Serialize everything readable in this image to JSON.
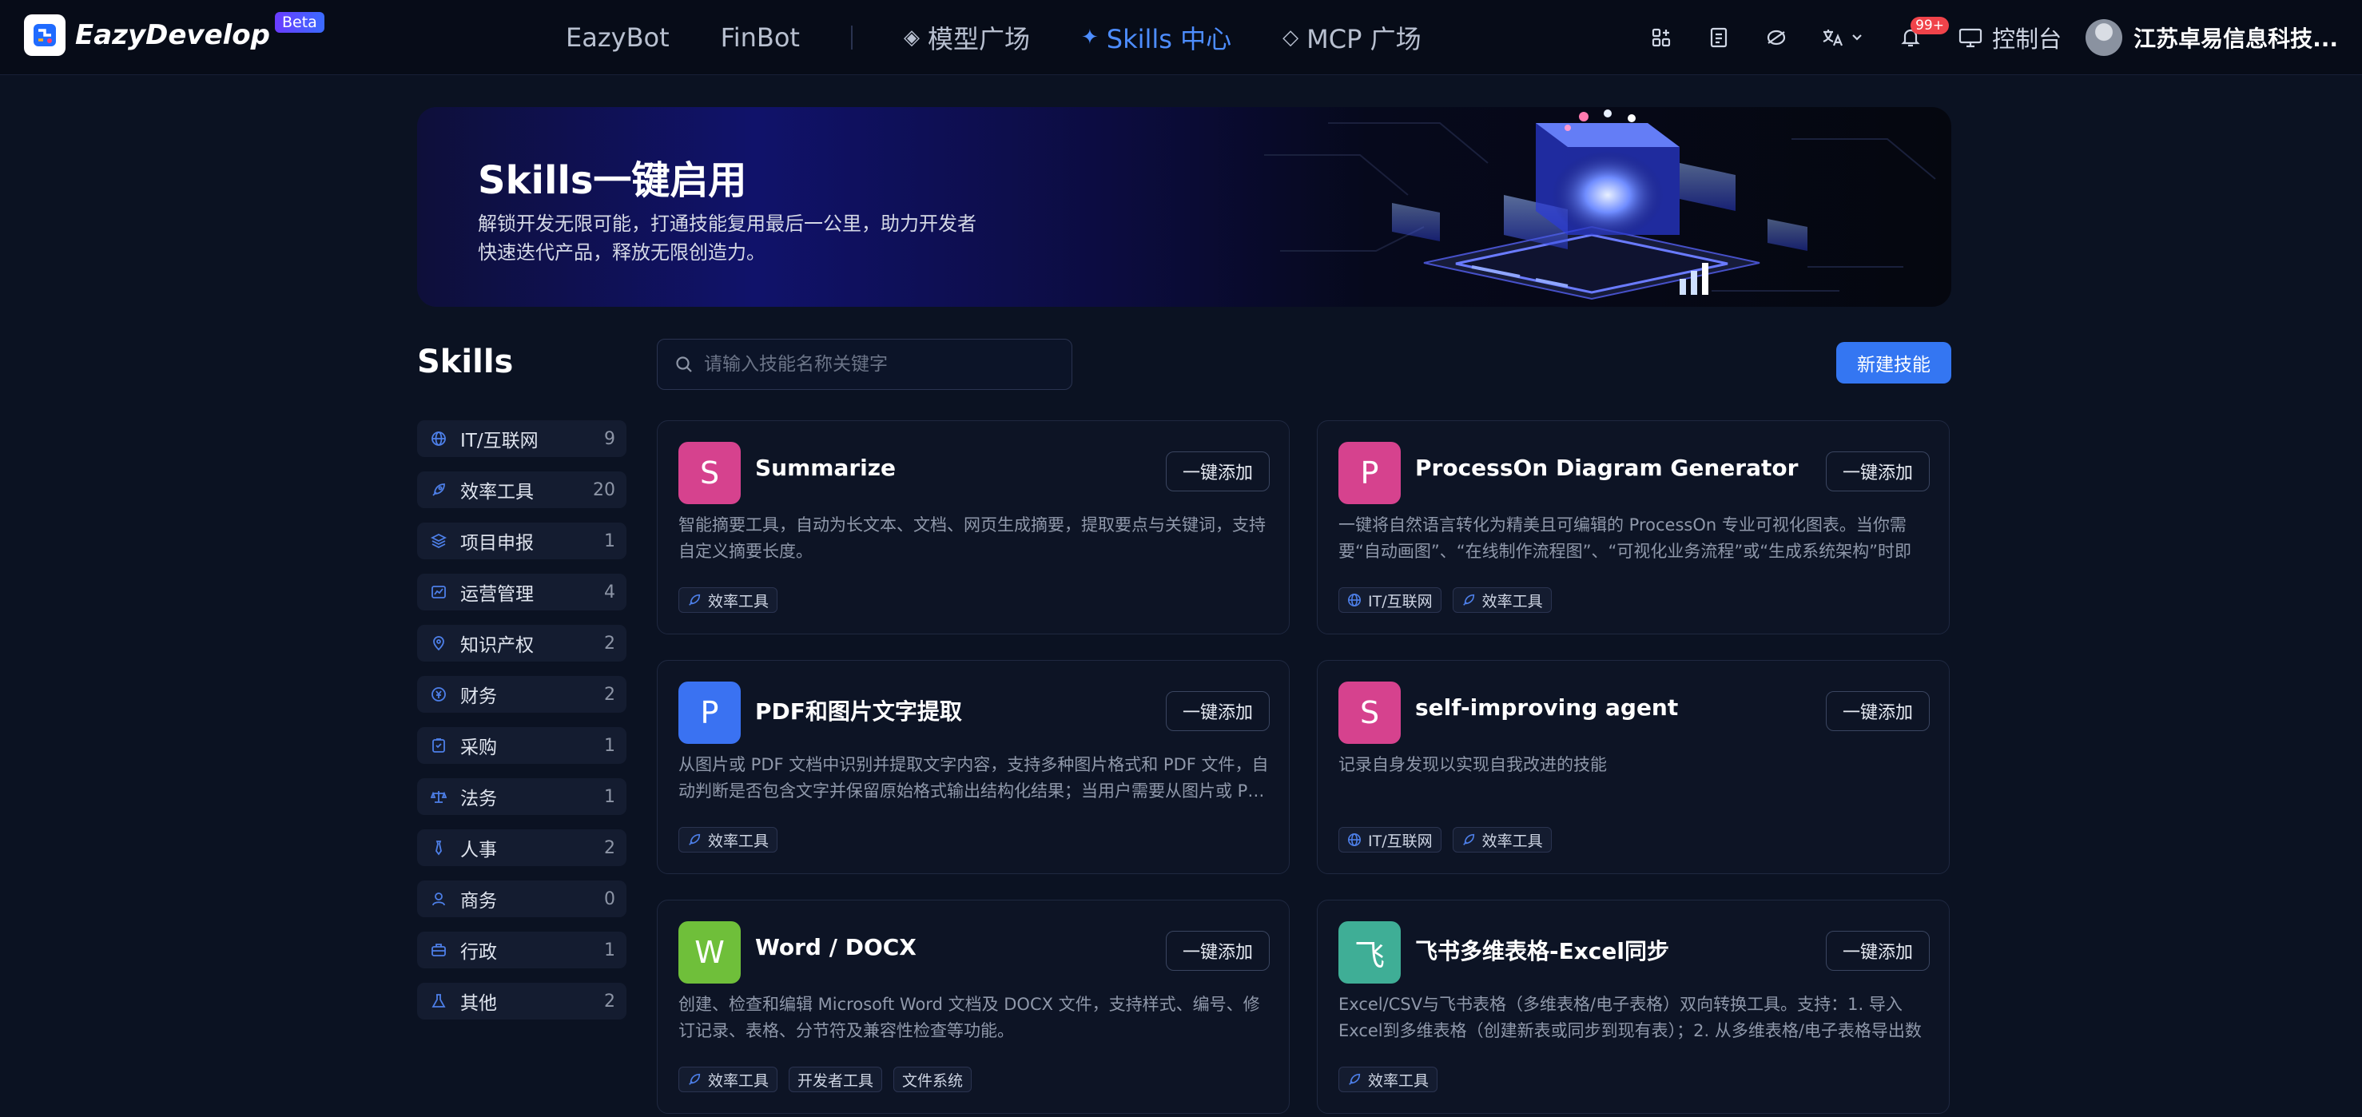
{
  "header": {
    "brand": "EazyDevelop",
    "beta": "Beta",
    "nav": [
      {
        "label": "EazyBot",
        "glyph": "",
        "active": false
      },
      {
        "label": "FinBot",
        "glyph": "",
        "active": false
      },
      {
        "label": "模型广场",
        "glyph": "◈",
        "active": false
      },
      {
        "label": "Skills 中心",
        "glyph": "✦",
        "active": true
      },
      {
        "label": "MCP 广场",
        "glyph": "◇",
        "active": false
      }
    ],
    "notification_badge": "99+",
    "console_label": "控制台",
    "company": "江苏卓易信息科技..."
  },
  "banner": {
    "title": "Skills一键启用",
    "description_line1": "解锁开发无限可能，打通技能复用最后一公里，助力开发者",
    "description_line2": "快速迭代产品，释放无限创造力。"
  },
  "section": {
    "title": "Skills",
    "search_placeholder": "请输入技能名称关键字",
    "new_button": "新建技能"
  },
  "categories": [
    {
      "label": "IT/互联网",
      "count": "9",
      "icon": "globe-icon"
    },
    {
      "label": "效率工具",
      "count": "20",
      "icon": "rocket-icon"
    },
    {
      "label": "项目申报",
      "count": "1",
      "icon": "layers-icon"
    },
    {
      "label": "运营管理",
      "count": "4",
      "icon": "chart-icon"
    },
    {
      "label": "知识产权",
      "count": "2",
      "icon": "location-icon"
    },
    {
      "label": "财务",
      "count": "2",
      "icon": "coin-icon"
    },
    {
      "label": "采购",
      "count": "1",
      "icon": "clipboard-icon"
    },
    {
      "label": "法务",
      "count": "1",
      "icon": "scale-icon"
    },
    {
      "label": "人事",
      "count": "2",
      "icon": "tie-icon"
    },
    {
      "label": "商务",
      "count": "0",
      "icon": "user-icon"
    },
    {
      "label": "行政",
      "count": "1",
      "icon": "briefcase-icon"
    },
    {
      "label": "其他",
      "count": "2",
      "icon": "flask-icon"
    }
  ],
  "add_label": "一键添加",
  "skills": [
    {
      "initial": "S",
      "color": "#d6428e",
      "name": "Summarize",
      "desc": "智能摘要工具，自动为长文本、文档、网页生成摘要，提取要点与关键词，支持自定义摘要长度。",
      "tags": [
        "效率工具"
      ]
    },
    {
      "initial": "P",
      "color": "#d6428e",
      "name": "ProcessOn Diagram Generator",
      "desc": "一键将自然语言转化为精美且可编辑的 ProcessOn 专业可视化图表。当你需要“自动画图”、“在线制作流程图”、“可视化业务流程”或“生成系统架构”时即可…",
      "tags": [
        "IT/互联网",
        "效率工具"
      ]
    },
    {
      "initial": "P",
      "color": "#3a72f2",
      "name": "PDF和图片文字提取",
      "desc": "从图片或 PDF 文档中识别并提取文字内容，支持多种图片格式和 PDF 文件，自动判断是否包含文字并保留原始格式输出结构化结果；当用户需要从图片或 P…",
      "tags": [
        "效率工具"
      ]
    },
    {
      "initial": "S",
      "color": "#d6428e",
      "name": "self-improving agent",
      "desc": "记录自身发现以实现自我改进的技能",
      "tags": [
        "IT/互联网",
        "效率工具"
      ]
    },
    {
      "initial": "W",
      "color": "#6fbf3a",
      "name": "Word / DOCX",
      "desc": "创建、检查和编辑 Microsoft Word 文档及 DOCX 文件，支持样式、编号、修订记录、表格、分节符及兼容性检查等功能。",
      "tags": [
        "效率工具",
        "开发者工具",
        "文件系统"
      ]
    },
    {
      "initial": "飞",
      "color": "#3fae96",
      "name": "飞书多维表格-Excel同步",
      "desc": "Excel/CSV与飞书表格（多维表格/电子表格）双向转换工具。支持：1. 导入Excel到多维表格（创建新表或同步到现有表）；2. 从多维表格/电子表格导出数据…",
      "tags": [
        "效率工具"
      ]
    }
  ]
}
